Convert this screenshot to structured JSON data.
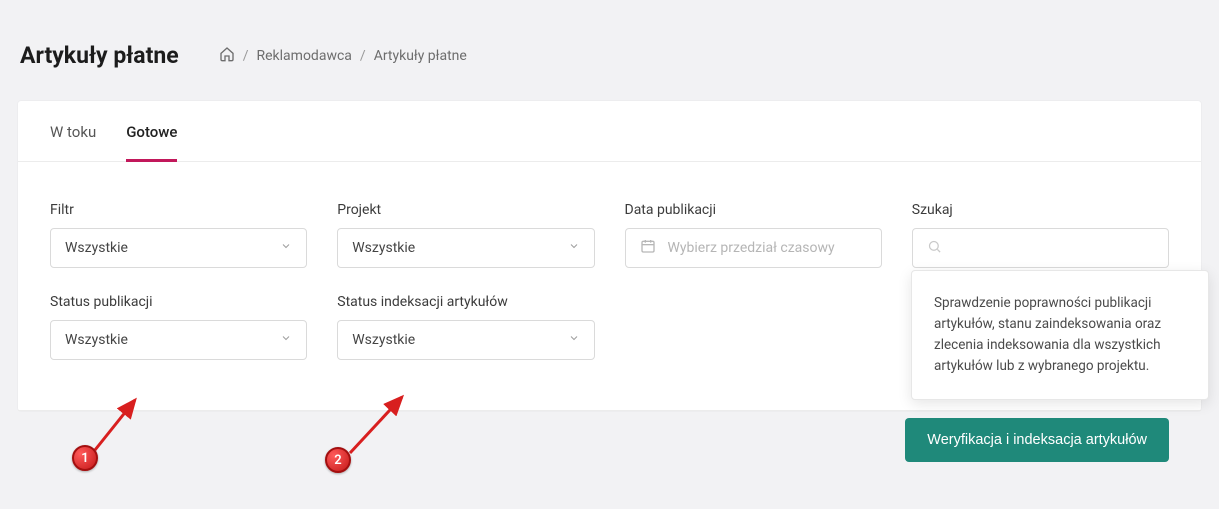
{
  "header": {
    "title": "Artykuły płatne",
    "breadcrumb": {
      "level1": "Reklamodawca",
      "level2": "Artykuły płatne"
    }
  },
  "tabs": {
    "items": [
      {
        "label": "W toku"
      },
      {
        "label": "Gotowe"
      }
    ],
    "active_index": 1
  },
  "filters": {
    "filtr": {
      "label": "Filtr",
      "value": "Wszystkie"
    },
    "projekt": {
      "label": "Projekt",
      "value": "Wszystkie"
    },
    "data_publikacji": {
      "label": "Data publikacji",
      "placeholder": "Wybierz przedział czasowy"
    },
    "szukaj": {
      "label": "Szukaj"
    },
    "status_publikacji": {
      "label": "Status publikacji",
      "value": "Wszystkie"
    },
    "status_indeksacji": {
      "label": "Status indeksacji artykułów",
      "value": "Wszystkie"
    }
  },
  "tooltip": {
    "text": "Sprawdzenie poprawności publikacji artykułów, stanu zaindeksowania oraz zlecenia indeksowania dla wszystkich artykułów lub z wybranego projektu."
  },
  "actions": {
    "verify_label": "Weryfikacja i indeksacja artykułów"
  },
  "annotations": {
    "marker1": "1",
    "marker2": "2"
  }
}
